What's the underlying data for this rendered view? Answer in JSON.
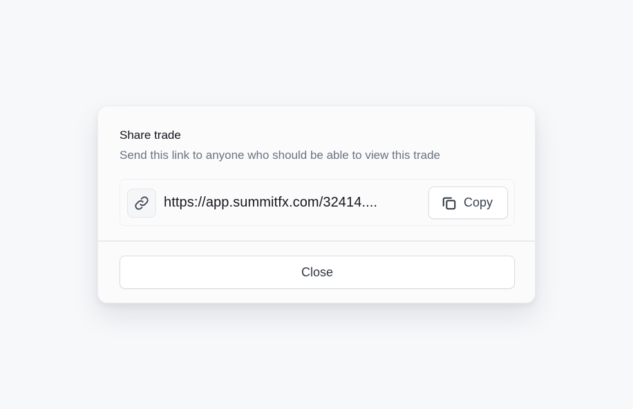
{
  "dialog": {
    "title": "Share trade",
    "subtitle": "Send this link to anyone who should be able to view this trade",
    "link_icon": "link-icon",
    "url_display": "https://app.summitfx.com/32414....",
    "copy_button": {
      "icon": "copy-icon",
      "label": "Copy"
    },
    "close_button": {
      "label": "Close"
    }
  },
  "colors": {
    "background": "#f7f8fa",
    "card": "#fbfbfc",
    "title_text": "#111318",
    "muted_text": "#6b7280",
    "border": "#d9dde2"
  }
}
